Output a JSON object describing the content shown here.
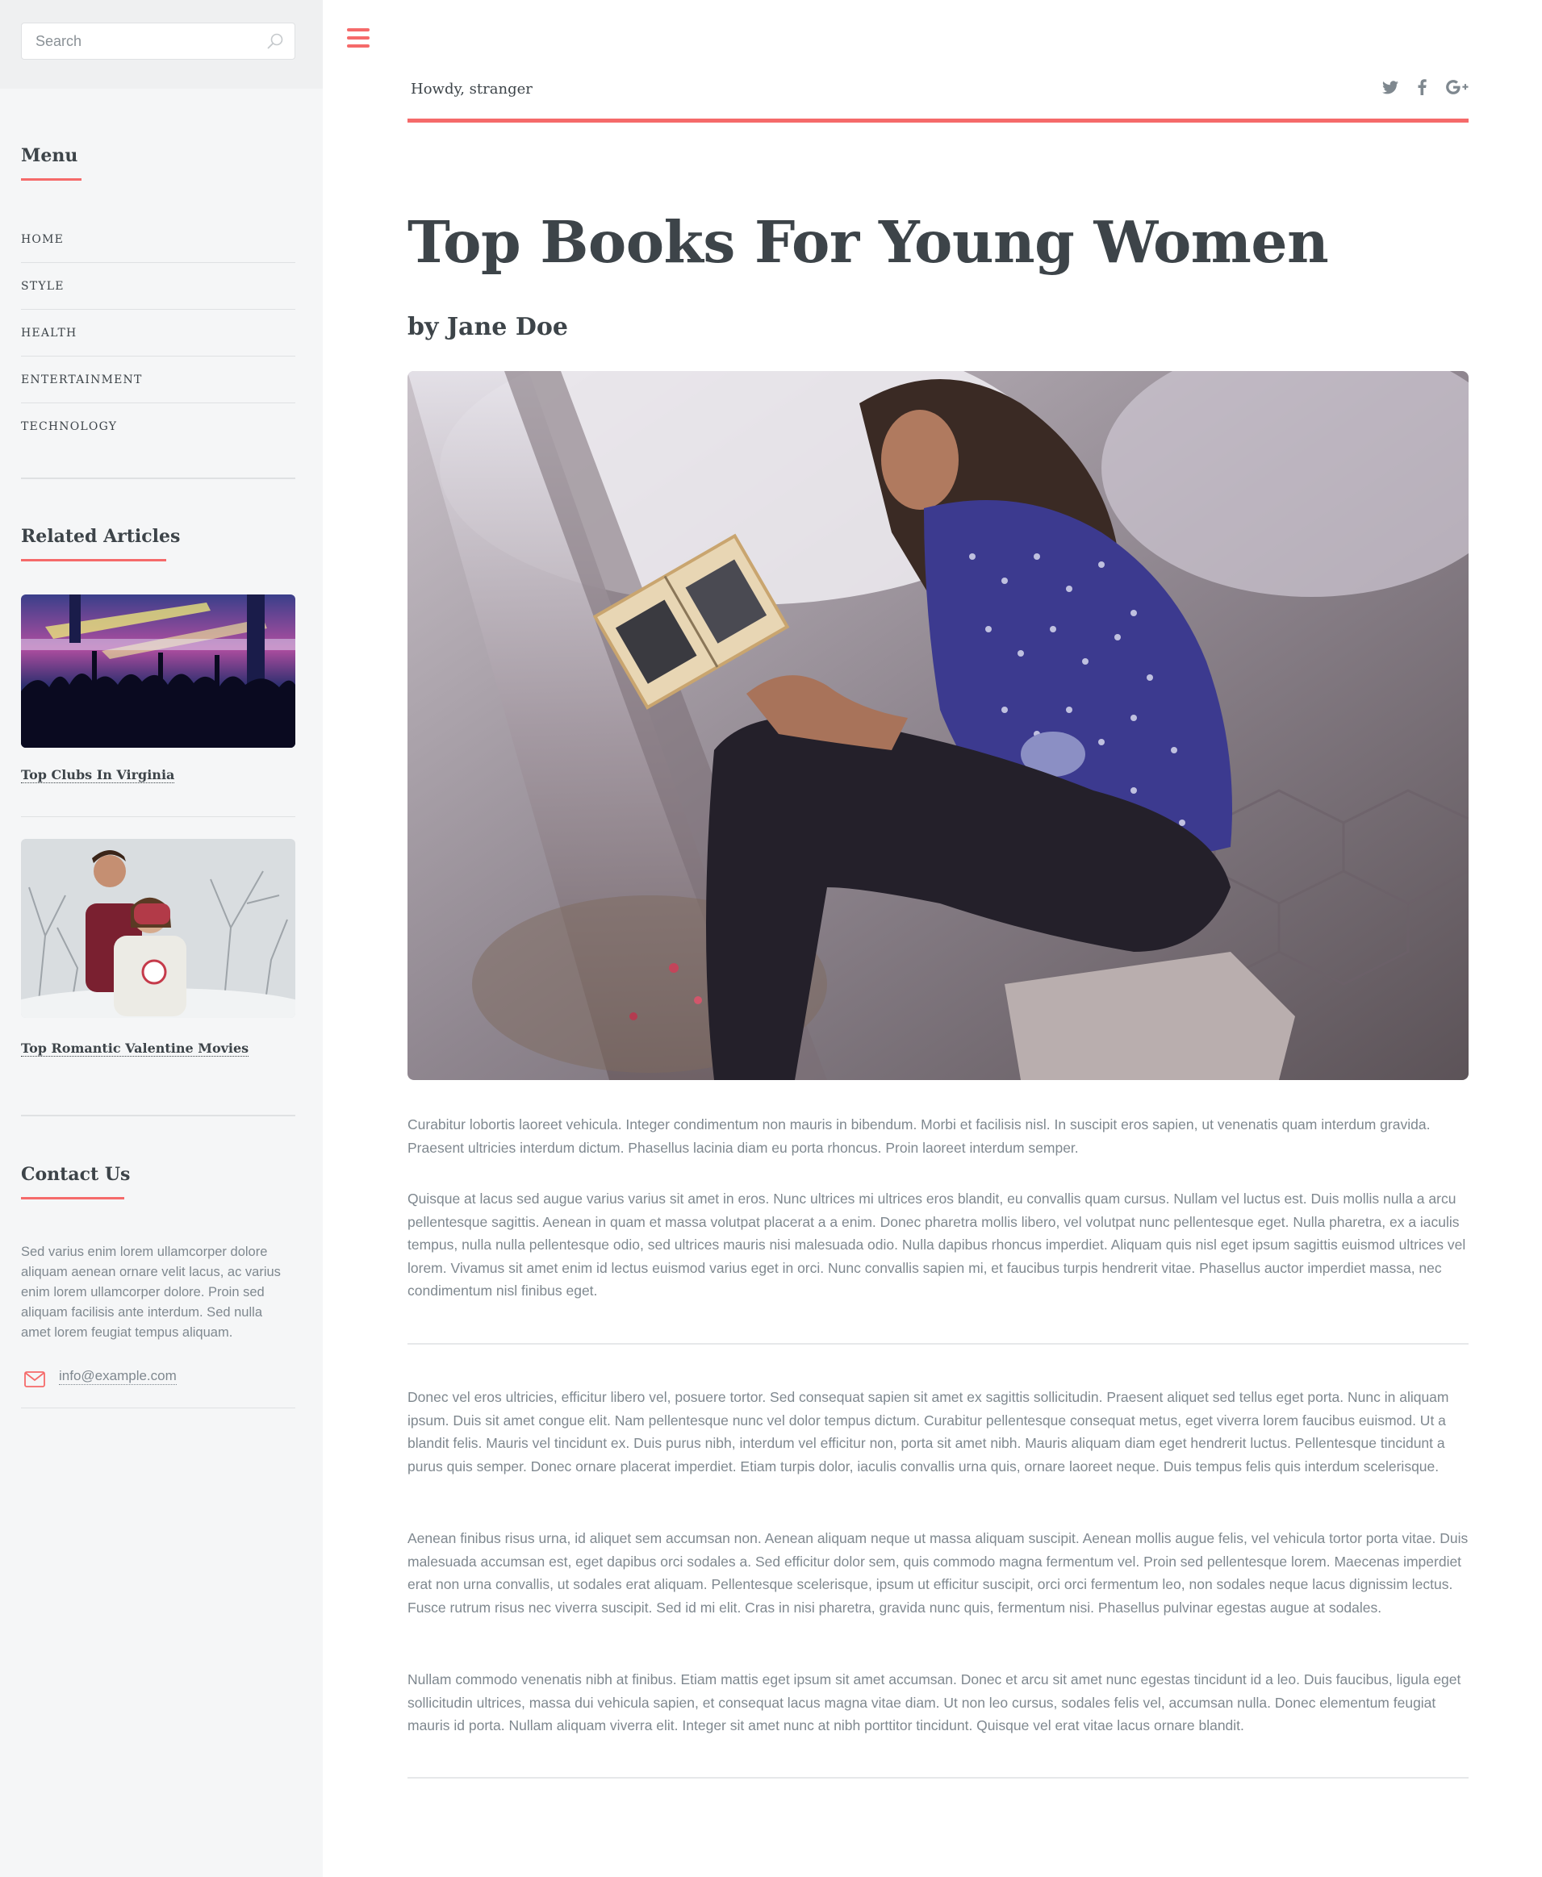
{
  "search": {
    "placeholder": "Search"
  },
  "sidebar": {
    "menu": {
      "title": "Menu",
      "items": [
        {
          "label": "HOME"
        },
        {
          "label": "STYLE"
        },
        {
          "label": "HEALTH"
        },
        {
          "label": "ENTERTAINMENT"
        },
        {
          "label": "TECHNOLOGY"
        }
      ]
    },
    "related": {
      "title": "Related Articles",
      "articles": [
        {
          "title": "Top Clubs In Virginia"
        },
        {
          "title": "Top Romantic Valentine Movies"
        }
      ]
    },
    "contact": {
      "title": "Contact Us",
      "text": "Sed varius enim lorem ullamcorper dolore aliquam aenean ornare velit lacus, ac varius enim lorem ullamcorper dolore. Proin sed aliquam facilisis ante interdum. Sed nulla amet lorem feugiat tempus aliquam.",
      "email": "info@example.com"
    }
  },
  "header": {
    "greeting": "Howdy, stranger",
    "social": [
      "twitter-icon",
      "facebook-icon",
      "google-plus-icon"
    ]
  },
  "article": {
    "title": "Top Books For Young Women",
    "author": "by Jane Doe",
    "paragraphs": [
      "Curabitur lobortis laoreet vehicula. Integer condimentum non mauris in bibendum. Morbi et facilisis nisl. In suscipit eros sapien, ut venenatis quam interdum gravida. Praesent ultricies interdum dictum. Phasellus lacinia diam eu porta rhoncus. Proin laoreet interdum semper.",
      "Quisque at lacus sed augue varius varius sit amet in eros. Nunc ultrices mi ultrices eros blandit, eu convallis quam cursus. Nullam vel luctus est. Duis mollis nulla a arcu pellentesque sagittis. Aenean in quam et massa volutpat placerat a a enim. Donec pharetra mollis libero, vel volutpat nunc pellentesque eget. Nulla pharetra, ex a iaculis tempus, nulla nulla pellentesque odio, sed ultrices mauris nisi malesuada odio. Nulla dapibus rhoncus imperdiet. Aliquam quis nisl eget ipsum sagittis euismod ultrices vel lorem. Vivamus sit amet enim id lectus euismod varius eget in orci. Nunc convallis sapien mi, et faucibus turpis hendrerit vitae. Phasellus auctor imperdiet massa, nec condimentum nisl finibus eget.",
      "Donec vel eros ultricies, efficitur libero vel, posuere tortor. Sed consequat sapien sit amet ex sagittis sollicitudin. Praesent aliquet sed tellus eget porta. Nunc in aliquam ipsum. Duis sit amet congue elit. Nam pellentesque nunc vel dolor tempus dictum. Curabitur pellentesque consequat metus, eget viverra lorem faucibus euismod. Ut a blandit felis. Mauris vel tincidunt ex. Duis purus nibh, interdum vel efficitur non, porta sit amet nibh. Mauris aliquam diam eget hendrerit luctus. Pellentesque tincidunt a purus quis semper. Donec ornare placerat imperdiet. Etiam turpis dolor, iaculis convallis urna quis, ornare laoreet neque. Duis tempus felis quis interdum scelerisque.",
      "Aenean finibus risus urna, id aliquet sem accumsan non. Aenean aliquam neque ut massa aliquam suscipit. Aenean mollis augue felis, vel vehicula tortor porta vitae. Duis malesuada accumsan est, eget dapibus orci sodales a. Sed efficitur dolor sem, quis commodo magna fermentum vel. Proin sed pellentesque lorem. Maecenas imperdiet erat non urna convallis, ut sodales erat aliquam. Pellentesque scelerisque, ipsum ut efficitur suscipit, orci orci fermentum leo, non sodales neque lacus dignissim lectus. Fusce rutrum risus nec viverra suscipit. Sed id mi elit. Cras in nisi pharetra, gravida nunc quis, fermentum nisi. Phasellus pulvinar egestas augue at sodales.",
      "Nullam commodo venenatis nibh at finibus. Etiam mattis eget ipsum sit amet accumsan. Donec et arcu sit amet nunc egestas tincidunt id a leo. Duis faucibus, ligula eget sollicitudin ultrices, massa dui vehicula sapien, et consequat lacus magna vitae diam. Ut non leo cursus, sodales felis vel, accumsan nulla. Donec elementum feugiat mauris id porta. Nullam aliquam viverra elit. Integer sit amet nunc at nibh porttitor tincidunt. Quisque vel erat vitae lacus ornare blandit."
    ]
  },
  "colors": {
    "accent": "#f56a6a",
    "heading": "#3d4449",
    "text": "#7f888f",
    "sidebar_bg": "#f5f6f7"
  }
}
